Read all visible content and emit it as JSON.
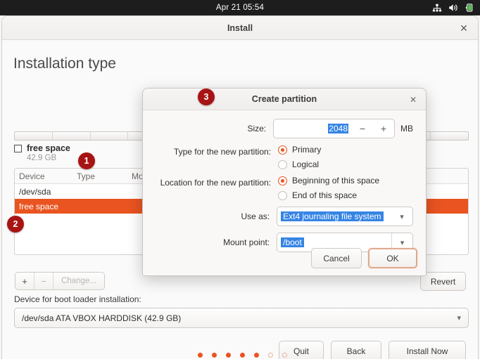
{
  "topbar": {
    "clock": "Apr 21  05:54",
    "icons": [
      "network-icon",
      "volume-icon",
      "battery-icon"
    ]
  },
  "window": {
    "title": "Install",
    "close_label": "✕"
  },
  "page": {
    "title": "Installation type",
    "legend": {
      "label": "free space",
      "size": "42.9 GB"
    },
    "table": {
      "columns": [
        "Device",
        "Type",
        "Mount point"
      ],
      "rows": [
        {
          "device": "/dev/sda",
          "type": "",
          "mount": "",
          "selected": false
        },
        {
          "device": "free space",
          "type": "",
          "mount": "",
          "selected": true
        }
      ]
    },
    "toolbar": {
      "add_label": "+",
      "remove_label": "−",
      "change_label": "Change..."
    },
    "revert_label": "Revert",
    "bootloader": {
      "label": "Device for boot loader installation:",
      "value": "/dev/sda ATA VBOX HARDDISK (42.9 GB)"
    },
    "footer": {
      "quit_label": "Quit",
      "back_label": "Back",
      "install_label": "Install Now"
    },
    "dots": {
      "total": 7,
      "filled": 5
    }
  },
  "dialog": {
    "title": "Create partition",
    "close_label": "✕",
    "size": {
      "label": "Size:",
      "value": "2048",
      "unit": "MB",
      "decrement_label": "−",
      "increment_label": "+"
    },
    "type": {
      "label": "Type for the new partition:",
      "options": [
        {
          "label": "Primary",
          "selected": true
        },
        {
          "label": "Logical",
          "selected": false
        }
      ]
    },
    "location": {
      "label": "Location for the new partition:",
      "options": [
        {
          "label": "Beginning of this space",
          "selected": true
        },
        {
          "label": "End of this space",
          "selected": false
        }
      ]
    },
    "use_as": {
      "label": "Use as:",
      "value": "Ext4 journaling file system"
    },
    "mount_point": {
      "label": "Mount point:",
      "value": "/boot"
    },
    "cancel_label": "Cancel",
    "ok_label": "OK"
  },
  "badges": {
    "one": "1",
    "two": "2",
    "three": "3"
  },
  "colors": {
    "accent": "#e95420",
    "selection": "#3584e4",
    "badge": "#a81414"
  }
}
